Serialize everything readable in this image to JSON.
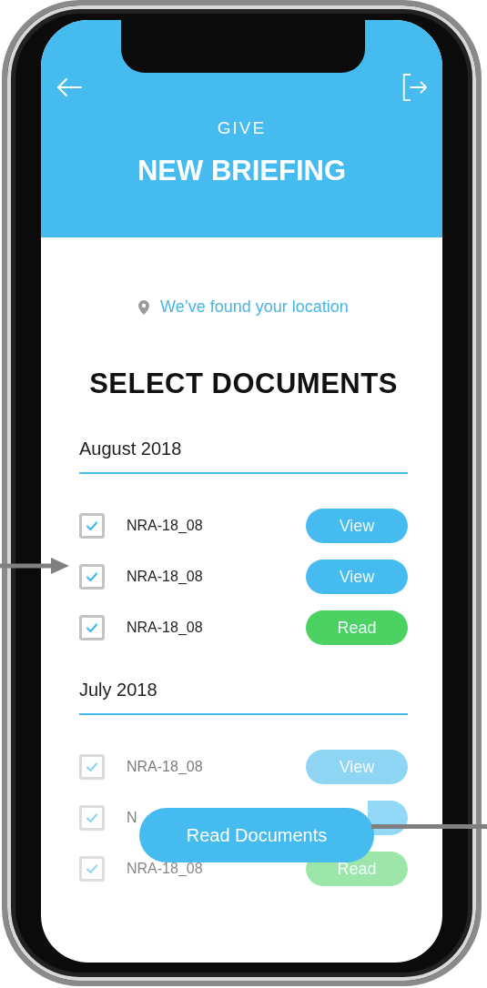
{
  "header": {
    "eyebrow": "GIVE",
    "title": "NEW BRIEFING"
  },
  "location": {
    "text": "We’ve found your location"
  },
  "heading": "SELECT DOCUMENTS",
  "groups": [
    {
      "month": "August 2018",
      "rows": [
        {
          "name": "NRA-18_08",
          "checked": true,
          "action": {
            "kind": "view",
            "label": "View"
          }
        },
        {
          "name": "NRA-18_08",
          "checked": true,
          "action": {
            "kind": "view",
            "label": "View"
          }
        },
        {
          "name": "NRA-18_08",
          "checked": true,
          "action": {
            "kind": "read",
            "label": "Read"
          }
        }
      ]
    },
    {
      "month": "July 2018",
      "rows": [
        {
          "name": "NRA-18_08",
          "checked": true,
          "action": {
            "kind": "view",
            "label": "View"
          }
        },
        {
          "name": "N",
          "checked": true,
          "action": {
            "kind": "view"
          }
        },
        {
          "name": "NRA-18_08",
          "checked": true,
          "action": {
            "kind": "read",
            "label": "Read"
          }
        }
      ]
    }
  ],
  "primary_button": "Read Documents"
}
